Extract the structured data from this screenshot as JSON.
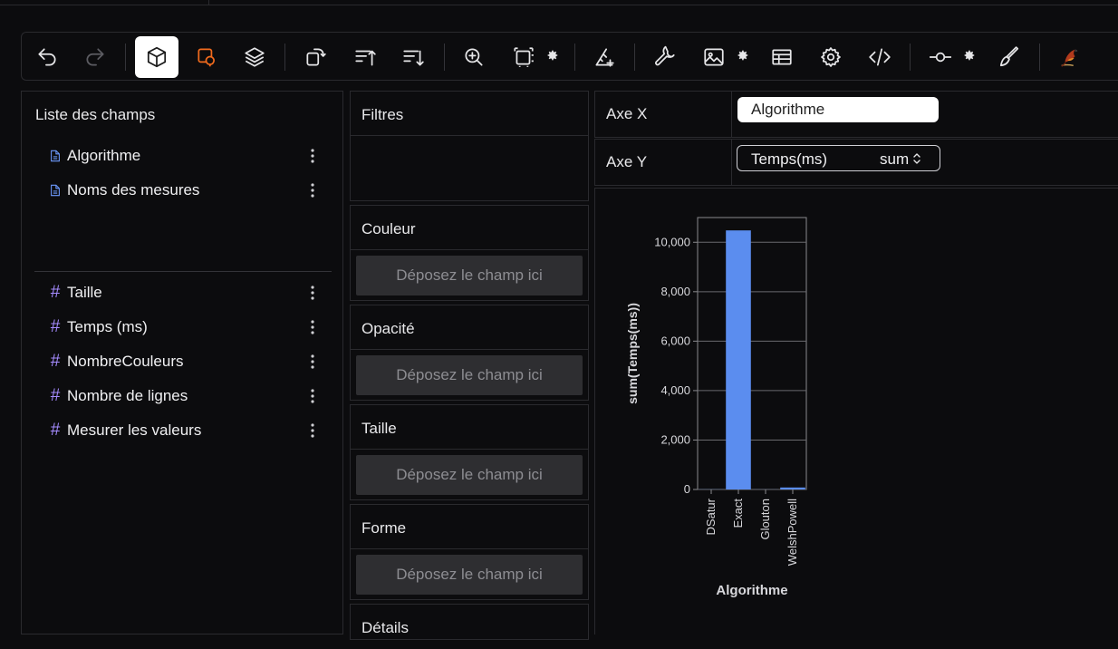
{
  "toolbar": {
    "icons": [
      "undo-icon",
      "redo-icon",
      "cube-icon",
      "select-shape-icon",
      "layers-icon",
      "transpose-icon",
      "sort-ascending-icon",
      "sort-descending-icon",
      "zoom-in-icon",
      "resize-icon",
      "settings-small-icon",
      "axis-crosshair-icon",
      "wrench-icon",
      "image-icon",
      "table-icon",
      "gear-icon",
      "code-icon",
      "commit-node-icon",
      "brush-icon",
      "bird-logo"
    ],
    "active": "cube-icon",
    "accent": "#f26b1d"
  },
  "fields_panel": {
    "title": "Liste des champs",
    "dimensions": [
      {
        "label": "Algorithme"
      },
      {
        "label": "Noms des mesures"
      }
    ],
    "measures": [
      {
        "label": "Taille"
      },
      {
        "label": "Temps (ms)"
      },
      {
        "label": "NombreCouleurs"
      },
      {
        "label": "Nombre de lignes"
      },
      {
        "label": "Mesurer les valeurs"
      }
    ]
  },
  "encodings": {
    "filters": "Filtres",
    "color": {
      "label": "Couleur",
      "drop": "Déposez le champ ici"
    },
    "opacity": {
      "label": "Opacité",
      "drop": "Déposez le champ ici"
    },
    "size": {
      "label": "Taille",
      "drop": "Déposez le champ ici"
    },
    "shape": {
      "label": "Forme",
      "drop": "Déposez le champ ici"
    },
    "details": {
      "label": "Détails"
    }
  },
  "axes": {
    "x": {
      "label": "Axe X",
      "field": "Algorithme"
    },
    "y": {
      "label": "Axe Y",
      "field": "Temps(ms)",
      "aggregate": "sum"
    }
  },
  "chart_data": {
    "type": "bar",
    "categories": [
      "DSatur",
      "Exact",
      "Glouton",
      "WelshPowell"
    ],
    "values": [
      5,
      10480,
      3,
      80
    ],
    "xlabel": "Algorithme",
    "ylabel": "sum(Temps(ms))",
    "ylim": [
      0,
      11000
    ],
    "yticks": [
      0,
      2000,
      4000,
      6000,
      8000,
      10000
    ],
    "ytick_labels": [
      "0",
      "2,000",
      "4,000",
      "6,000",
      "8,000",
      "10,000"
    ],
    "grid": true,
    "bar_color": "#5b8def"
  }
}
